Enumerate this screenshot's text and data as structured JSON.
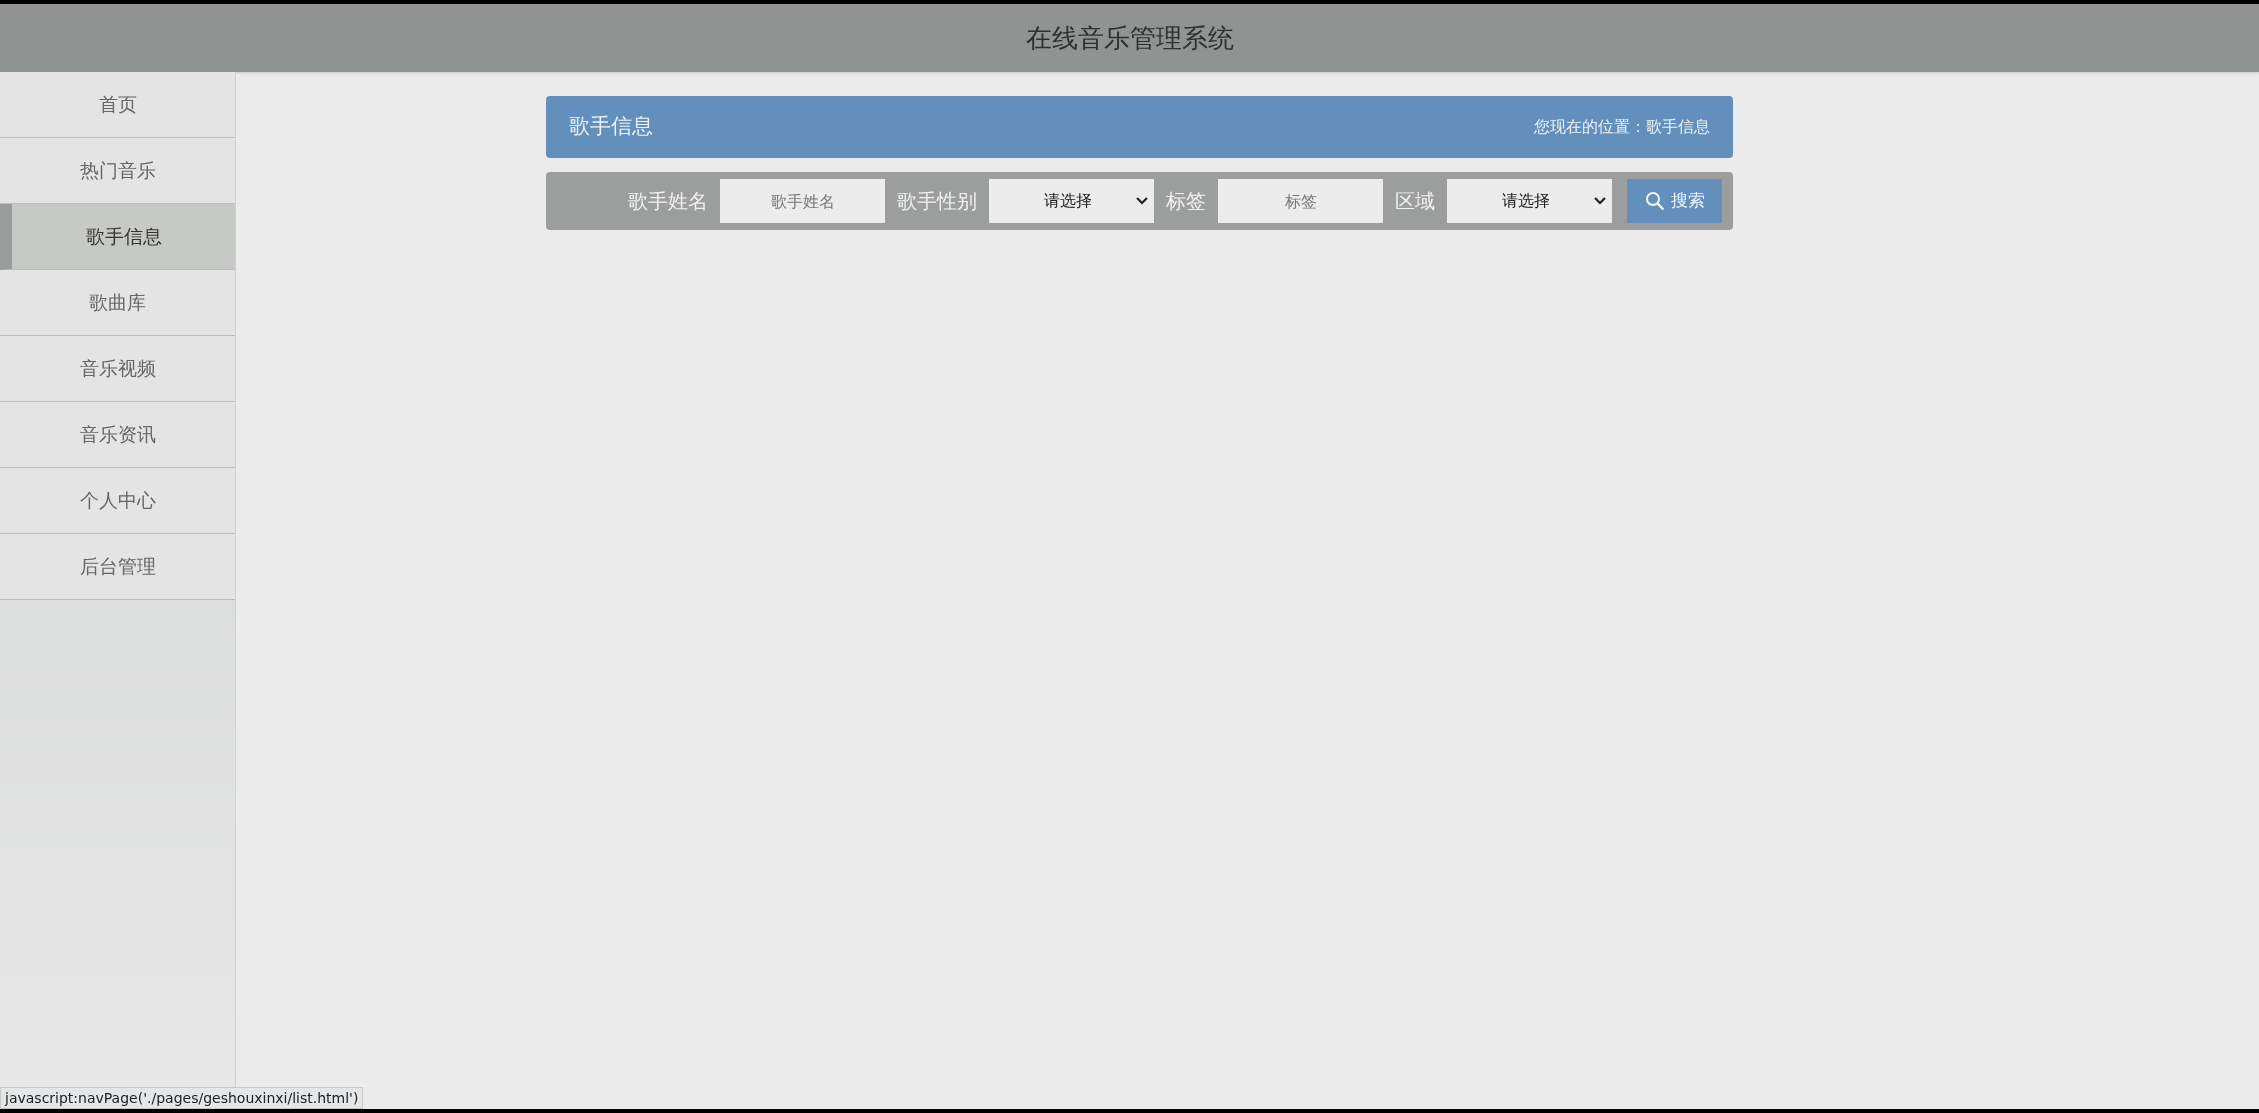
{
  "header": {
    "title": "在线音乐管理系统"
  },
  "sidebar": {
    "items": [
      {
        "label": "首页",
        "selected": false
      },
      {
        "label": "热门音乐",
        "selected": false
      },
      {
        "label": "歌手信息",
        "selected": true
      },
      {
        "label": "歌曲库",
        "selected": false
      },
      {
        "label": "音乐视频",
        "selected": false
      },
      {
        "label": "音乐资讯",
        "selected": false
      },
      {
        "label": "个人中心",
        "selected": false
      },
      {
        "label": "后台管理",
        "selected": false
      }
    ]
  },
  "panel": {
    "title": "歌手信息",
    "breadcrumb": "您现在的位置：歌手信息"
  },
  "search": {
    "fields": [
      {
        "kind": "text",
        "label": "歌手姓名",
        "placeholder": "歌手姓名"
      },
      {
        "kind": "select",
        "label": "歌手性别",
        "value": "请选择"
      },
      {
        "kind": "text",
        "label": "标签",
        "placeholder": "标签"
      },
      {
        "kind": "select",
        "label": "区域",
        "value": "请选择"
      }
    ],
    "button": "搜索"
  },
  "status_bar": {
    "url": "javascript:navPage('./pages/geshouxinxi/list.html')"
  }
}
